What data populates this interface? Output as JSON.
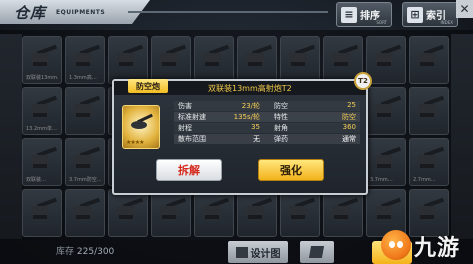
{
  "header": {
    "title": "仓库",
    "subtitle": "EQUIPMENTS",
    "sort_label": "排序",
    "sort_sub": "SORT",
    "index_label": "索引",
    "index_sub": "INDEX",
    "close_glyph": "✕"
  },
  "grid": {
    "captions": [
      "双联装13mm…",
      "1.3mm高…",
      "",
      "",
      "",
      "",
      "",
      "",
      "",
      "",
      "13.2mm单…",
      "",
      "",
      "",
      "",
      "",
      "",
      "",
      "",
      "",
      "双联装…",
      "3.7mm防空…",
      "",
      "",
      "",
      "",
      "",
      "",
      "3.7mm…",
      "2.7mm…",
      "",
      "",
      "",
      "",
      "",
      "",
      "",
      "",
      "",
      ""
    ]
  },
  "modal": {
    "type_badge": "防空炮",
    "item_name": "双联装13mm高射炮T2",
    "tier": "T2",
    "stars": "★★★★",
    "stats": [
      {
        "label": "伤害",
        "value": "23/轮"
      },
      {
        "label": "防空",
        "value": "25"
      },
      {
        "label": "标准射速",
        "value": "135s/轮"
      },
      {
        "label": "特性",
        "value": "防空"
      },
      {
        "label": "射程",
        "value": "35"
      },
      {
        "label": "射角",
        "value": "360"
      },
      {
        "label": "散布范围",
        "value": "无"
      },
      {
        "label": "弹药",
        "value": "通常"
      }
    ],
    "dismantle_label": "拆解",
    "upgrade_label": "强化"
  },
  "footer": {
    "stock_prefix": "库存",
    "stock_value": "225/300",
    "design_label": "设计图"
  },
  "watermark": {
    "text": "九游"
  },
  "colors": {
    "accent_yellow": "#f3b21b",
    "value_yellow": "#f5cf55",
    "dismantle_red": "#d62a1e",
    "panel_border": "#c9ced5"
  }
}
